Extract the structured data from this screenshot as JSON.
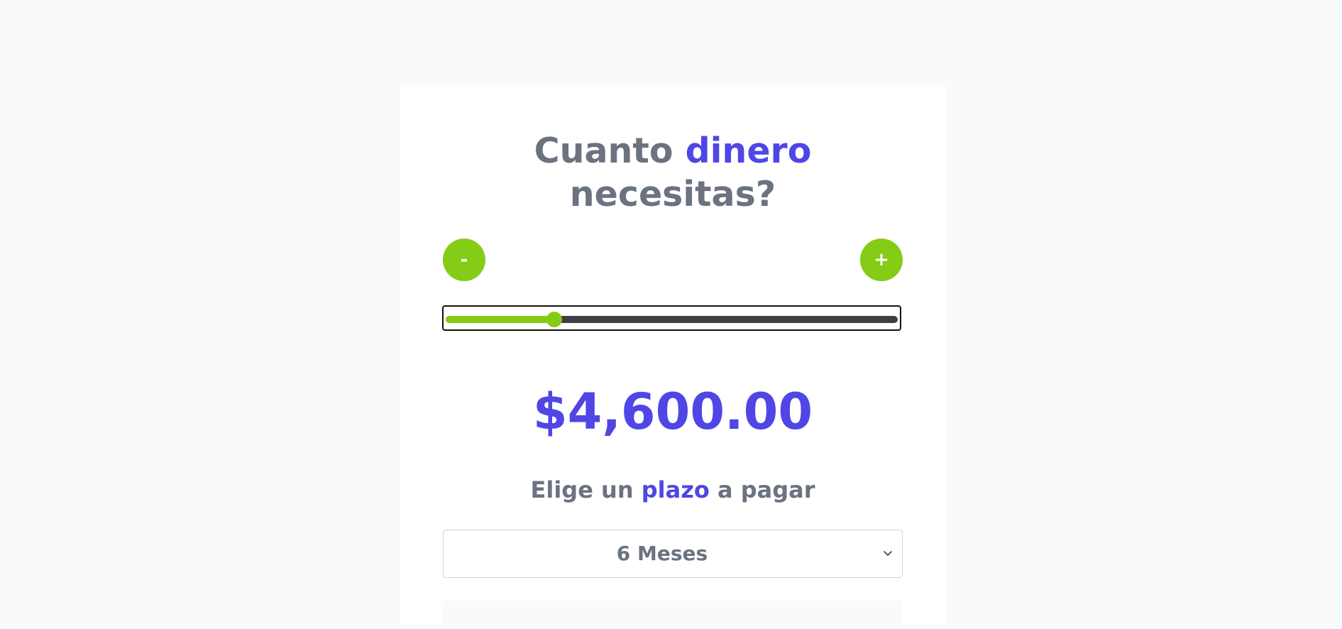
{
  "title": {
    "part1": "Cuanto ",
    "accent": "dinero",
    "part2": "necesitas?"
  },
  "controls": {
    "minus_label": "-",
    "plus_label": "+"
  },
  "slider": {
    "value_fraction": 0.24
  },
  "amount": "$4,600.00",
  "term": {
    "part1": "Elige un ",
    "accent": "plazo",
    "part2": " a pagar"
  },
  "term_select": {
    "selected": "6 Meses"
  },
  "colors": {
    "accent": "#4f46e5",
    "green": "#84cc16",
    "text_gray": "#6b7280",
    "track": "#3f3f46"
  },
  "icons": {
    "select_arrow": "chevron-down-icon"
  }
}
